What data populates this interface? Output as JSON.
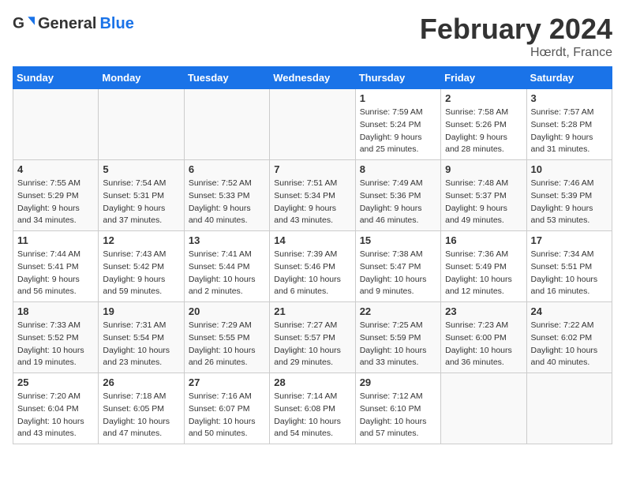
{
  "header": {
    "logo_general": "General",
    "logo_blue": "Blue",
    "title": "February 2024",
    "location": "Hœrdt, France"
  },
  "days_of_week": [
    "Sunday",
    "Monday",
    "Tuesday",
    "Wednesday",
    "Thursday",
    "Friday",
    "Saturday"
  ],
  "weeks": [
    {
      "days": [
        {
          "num": "",
          "empty": true
        },
        {
          "num": "",
          "empty": true
        },
        {
          "num": "",
          "empty": true
        },
        {
          "num": "",
          "empty": true
        },
        {
          "num": "1",
          "sunrise": "7:59 AM",
          "sunset": "5:24 PM",
          "daylight": "9 hours and 25 minutes."
        },
        {
          "num": "2",
          "sunrise": "7:58 AM",
          "sunset": "5:26 PM",
          "daylight": "9 hours and 28 minutes."
        },
        {
          "num": "3",
          "sunrise": "7:57 AM",
          "sunset": "5:28 PM",
          "daylight": "9 hours and 31 minutes."
        }
      ]
    },
    {
      "days": [
        {
          "num": "4",
          "sunrise": "7:55 AM",
          "sunset": "5:29 PM",
          "daylight": "9 hours and 34 minutes."
        },
        {
          "num": "5",
          "sunrise": "7:54 AM",
          "sunset": "5:31 PM",
          "daylight": "9 hours and 37 minutes."
        },
        {
          "num": "6",
          "sunrise": "7:52 AM",
          "sunset": "5:33 PM",
          "daylight": "9 hours and 40 minutes."
        },
        {
          "num": "7",
          "sunrise": "7:51 AM",
          "sunset": "5:34 PM",
          "daylight": "9 hours and 43 minutes."
        },
        {
          "num": "8",
          "sunrise": "7:49 AM",
          "sunset": "5:36 PM",
          "daylight": "9 hours and 46 minutes."
        },
        {
          "num": "9",
          "sunrise": "7:48 AM",
          "sunset": "5:37 PM",
          "daylight": "9 hours and 49 minutes."
        },
        {
          "num": "10",
          "sunrise": "7:46 AM",
          "sunset": "5:39 PM",
          "daylight": "9 hours and 53 minutes."
        }
      ]
    },
    {
      "days": [
        {
          "num": "11",
          "sunrise": "7:44 AM",
          "sunset": "5:41 PM",
          "daylight": "9 hours and 56 minutes."
        },
        {
          "num": "12",
          "sunrise": "7:43 AM",
          "sunset": "5:42 PM",
          "daylight": "9 hours and 59 minutes."
        },
        {
          "num": "13",
          "sunrise": "7:41 AM",
          "sunset": "5:44 PM",
          "daylight": "10 hours and 2 minutes."
        },
        {
          "num": "14",
          "sunrise": "7:39 AM",
          "sunset": "5:46 PM",
          "daylight": "10 hours and 6 minutes."
        },
        {
          "num": "15",
          "sunrise": "7:38 AM",
          "sunset": "5:47 PM",
          "daylight": "10 hours and 9 minutes."
        },
        {
          "num": "16",
          "sunrise": "7:36 AM",
          "sunset": "5:49 PM",
          "daylight": "10 hours and 12 minutes."
        },
        {
          "num": "17",
          "sunrise": "7:34 AM",
          "sunset": "5:51 PM",
          "daylight": "10 hours and 16 minutes."
        }
      ]
    },
    {
      "days": [
        {
          "num": "18",
          "sunrise": "7:33 AM",
          "sunset": "5:52 PM",
          "daylight": "10 hours and 19 minutes."
        },
        {
          "num": "19",
          "sunrise": "7:31 AM",
          "sunset": "5:54 PM",
          "daylight": "10 hours and 23 minutes."
        },
        {
          "num": "20",
          "sunrise": "7:29 AM",
          "sunset": "5:55 PM",
          "daylight": "10 hours and 26 minutes."
        },
        {
          "num": "21",
          "sunrise": "7:27 AM",
          "sunset": "5:57 PM",
          "daylight": "10 hours and 29 minutes."
        },
        {
          "num": "22",
          "sunrise": "7:25 AM",
          "sunset": "5:59 PM",
          "daylight": "10 hours and 33 minutes."
        },
        {
          "num": "23",
          "sunrise": "7:23 AM",
          "sunset": "6:00 PM",
          "daylight": "10 hours and 36 minutes."
        },
        {
          "num": "24",
          "sunrise": "7:22 AM",
          "sunset": "6:02 PM",
          "daylight": "10 hours and 40 minutes."
        }
      ]
    },
    {
      "days": [
        {
          "num": "25",
          "sunrise": "7:20 AM",
          "sunset": "6:04 PM",
          "daylight": "10 hours and 43 minutes."
        },
        {
          "num": "26",
          "sunrise": "7:18 AM",
          "sunset": "6:05 PM",
          "daylight": "10 hours and 47 minutes."
        },
        {
          "num": "27",
          "sunrise": "7:16 AM",
          "sunset": "6:07 PM",
          "daylight": "10 hours and 50 minutes."
        },
        {
          "num": "28",
          "sunrise": "7:14 AM",
          "sunset": "6:08 PM",
          "daylight": "10 hours and 54 minutes."
        },
        {
          "num": "29",
          "sunrise": "7:12 AM",
          "sunset": "6:10 PM",
          "daylight": "10 hours and 57 minutes."
        },
        {
          "num": "",
          "empty": true
        },
        {
          "num": "",
          "empty": true
        }
      ]
    }
  ],
  "labels": {
    "sunrise": "Sunrise:",
    "sunset": "Sunset:",
    "daylight": "Daylight:"
  }
}
